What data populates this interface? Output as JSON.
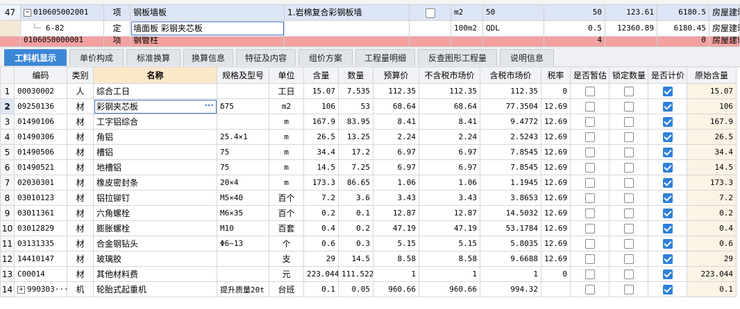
{
  "top": {
    "row47": {
      "num": "47",
      "code": "010605002001",
      "type": "项",
      "name": "钢板墙板",
      "feature": "1.岩棉复合彩钢板墙",
      "unit": "m2",
      "qty_expr": "50",
      "qty": "50",
      "price": "123.61",
      "total": "6180.5",
      "category": "房屋建筑"
    },
    "row_sub": {
      "code": "6-82",
      "type": "定",
      "name": "墙面板 彩钢夹芯板",
      "unit": "100m2",
      "qty_expr": "QDL",
      "qty": "0.5",
      "price": "12360.89",
      "total": "6180.45",
      "category": "房屋建筑"
    },
    "partial_row": {
      "code": "0106050000001",
      "type": "项",
      "name": "钢管柱",
      "qty": "4",
      "total": "0",
      "category": "房屋建筑"
    }
  },
  "tabs": [
    "工料机显示",
    "单价构成",
    "标准换算",
    "换算信息",
    "特征及内容",
    "组价方案",
    "工程量明细",
    "反查图形工程量",
    "说明信息"
  ],
  "columns": [
    "编码",
    "类别",
    "名称",
    "规格及型号",
    "单位",
    "含量",
    "数量",
    "预算价",
    "不含税市场价",
    "含税市场价",
    "税率",
    "是否暂估",
    "锁定数量",
    "是否计价",
    "原始含量"
  ],
  "rows": [
    {
      "n": "1",
      "code": "00030002",
      "type": "人",
      "name": "综合工日",
      "spec": "",
      "unit": "工日",
      "content": "15.07",
      "qty": "7.535",
      "budget": "112.35",
      "market_ex": "112.35",
      "market_in": "112.35",
      "tax": "0",
      "est": false,
      "lock": false,
      "priced": true,
      "orig": "15.07"
    },
    {
      "n": "2",
      "code": "09250136",
      "type": "材",
      "name": "彩钢夹芯板",
      "spec": "δ75",
      "unit": "m2",
      "content": "106",
      "qty": "53",
      "budget": "68.64",
      "market_ex": "68.64",
      "market_in": "77.3504",
      "tax": "12.69",
      "est": false,
      "lock": false,
      "priced": true,
      "orig": "106"
    },
    {
      "n": "3",
      "code": "01490106",
      "type": "材",
      "name": "工字铝综合",
      "spec": "",
      "unit": "m",
      "content": "167.9",
      "qty": "83.95",
      "budget": "8.41",
      "market_ex": "8.41",
      "market_in": "9.4772",
      "tax": "12.69",
      "est": false,
      "lock": false,
      "priced": true,
      "orig": "167.9"
    },
    {
      "n": "4",
      "code": "01490306",
      "type": "材",
      "name": "角铝",
      "spec": "25.4×1",
      "unit": "m",
      "content": "26.5",
      "qty": "13.25",
      "budget": "2.24",
      "market_ex": "2.24",
      "market_in": "2.5243",
      "tax": "12.69",
      "est": false,
      "lock": false,
      "priced": true,
      "orig": "26.5"
    },
    {
      "n": "5",
      "code": "01490506",
      "type": "材",
      "name": "槽铝",
      "spec": "75",
      "unit": "m",
      "content": "34.4",
      "qty": "17.2",
      "budget": "6.97",
      "market_ex": "6.97",
      "market_in": "7.8545",
      "tax": "12.69",
      "est": false,
      "lock": false,
      "priced": true,
      "orig": "34.4"
    },
    {
      "n": "6",
      "code": "01490521",
      "type": "材",
      "name": "地槽铝",
      "spec": "75",
      "unit": "m",
      "content": "14.5",
      "qty": "7.25",
      "budget": "6.97",
      "market_ex": "6.97",
      "market_in": "7.8545",
      "tax": "12.69",
      "est": false,
      "lock": false,
      "priced": true,
      "orig": "14.5"
    },
    {
      "n": "7",
      "code": "02030301",
      "type": "材",
      "name": "橡皮密封条",
      "spec": "20×4",
      "unit": "m",
      "content": "173.3",
      "qty": "86.65",
      "budget": "1.06",
      "market_ex": "1.06",
      "market_in": "1.1945",
      "tax": "12.69",
      "est": false,
      "lock": false,
      "priced": true,
      "orig": "173.3"
    },
    {
      "n": "8",
      "code": "03010123",
      "type": "材",
      "name": "铝拉铆钉",
      "spec": "M5×40",
      "unit": "百个",
      "content": "7.2",
      "qty": "3.6",
      "budget": "3.43",
      "market_ex": "3.43",
      "market_in": "3.8653",
      "tax": "12.69",
      "est": false,
      "lock": false,
      "priced": true,
      "orig": "7.2"
    },
    {
      "n": "9",
      "code": "03011361",
      "type": "材",
      "name": "六角螺栓",
      "spec": "M6×35",
      "unit": "百个",
      "content": "0.2",
      "qty": "0.1",
      "budget": "12.87",
      "market_ex": "12.87",
      "market_in": "14.5032",
      "tax": "12.69",
      "est": false,
      "lock": false,
      "priced": true,
      "orig": "0.2"
    },
    {
      "n": "10",
      "code": "03012829",
      "type": "材",
      "name": "膨胀螺栓",
      "spec": "M10",
      "unit": "百套",
      "content": "0.4",
      "qty": "0.2",
      "budget": "47.19",
      "market_ex": "47.19",
      "market_in": "53.1784",
      "tax": "12.69",
      "est": false,
      "lock": false,
      "priced": true,
      "orig": "0.4"
    },
    {
      "n": "11",
      "code": "03131335",
      "type": "材",
      "name": "合金钢钻头",
      "spec": "Φ6~13",
      "unit": "个",
      "content": "0.6",
      "qty": "0.3",
      "budget": "5.15",
      "market_ex": "5.15",
      "market_in": "5.8035",
      "tax": "12.69",
      "est": false,
      "lock": false,
      "priced": true,
      "orig": "0.6"
    },
    {
      "n": "12",
      "code": "14410147",
      "type": "材",
      "name": "玻璃胶",
      "spec": "",
      "unit": "支",
      "content": "29",
      "qty": "14.5",
      "budget": "8.58",
      "market_ex": "8.58",
      "market_in": "9.6688",
      "tax": "12.69",
      "est": false,
      "lock": false,
      "priced": true,
      "orig": "29"
    },
    {
      "n": "13",
      "code": "C00014",
      "type": "材",
      "name": "其他材料费",
      "spec": "",
      "unit": "元",
      "content": "223.044",
      "qty": "111.522",
      "budget": "1",
      "market_ex": "1",
      "market_in": "1",
      "tax": "0",
      "est": false,
      "lock": false,
      "priced": true,
      "orig": "223.044"
    },
    {
      "n": "14",
      "code": "990303···",
      "type": "机",
      "name": "轮胎式起重机",
      "spec": "提升质量20t",
      "unit": "台班",
      "content": "0.1",
      "qty": "0.05",
      "budget": "960.66",
      "market_ex": "960.66",
      "market_in": "994.32",
      "tax": "",
      "est": false,
      "lock": false,
      "priced": true,
      "orig": "0.1"
    }
  ],
  "ellipsis": "···",
  "expander_minus": "−",
  "expander_plus": "+"
}
